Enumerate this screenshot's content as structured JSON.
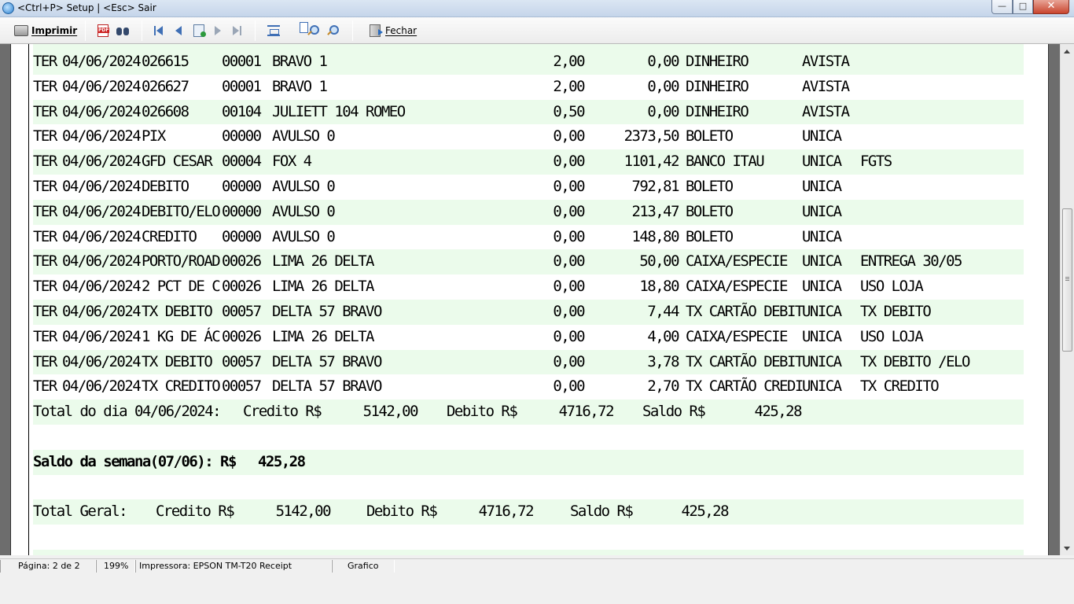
{
  "window": {
    "title": "<Ctrl+P> Setup | <Esc> Sair",
    "controls": {
      "minimize": "—",
      "maximize": "□",
      "close": "✕"
    }
  },
  "toolbar": {
    "print_label": "Imprimir",
    "close_label": "Fechar",
    "icons": [
      "printer-icon",
      "pdf-icon",
      "binoculars-icon",
      "first-page-icon",
      "prev-page-icon",
      "goto-page-icon",
      "next-page-icon",
      "last-page-icon",
      "fit-width-icon",
      "whole-page-icon",
      "zoom-in-icon",
      "zoom-out-icon",
      "exit-icon"
    ]
  },
  "report": {
    "rows": [
      {
        "day": "TER",
        "date": "04/06/2024",
        "doc": "026615",
        "code": "00001",
        "name": "BRAVO 1",
        "debit": "2,00",
        "credit": "0,00",
        "account": "DINHEIRO",
        "cond": "AVISTA",
        "obs": "",
        "green": true
      },
      {
        "day": "TER",
        "date": "04/06/2024",
        "doc": "026627",
        "code": "00001",
        "name": "BRAVO 1",
        "debit": "2,00",
        "credit": "0,00",
        "account": "DINHEIRO",
        "cond": "AVISTA",
        "obs": "",
        "green": false
      },
      {
        "day": "TER",
        "date": "04/06/2024",
        "doc": "026608",
        "code": "00104",
        "name": "JULIETT 104 ROMEO",
        "debit": "0,50",
        "credit": "0,00",
        "account": "DINHEIRO",
        "cond": "AVISTA",
        "obs": "",
        "green": true
      },
      {
        "day": "TER",
        "date": "04/06/2024",
        "doc": "PIX",
        "code": "00000",
        "name": "AVULSO 0",
        "debit": "0,00",
        "credit": "2373,50",
        "account": "BOLETO",
        "cond": "UNICA",
        "obs": "",
        "green": false
      },
      {
        "day": "TER",
        "date": "04/06/2024",
        "doc": "GFD CESAR",
        "code": "00004",
        "name": "FOX 4",
        "debit": "0,00",
        "credit": "1101,42",
        "account": "BANCO ITAU",
        "cond": "UNICA",
        "obs": "FGTS",
        "green": true
      },
      {
        "day": "TER",
        "date": "04/06/2024",
        "doc": "DEBITO",
        "code": "00000",
        "name": "AVULSO 0",
        "debit": "0,00",
        "credit": "792,81",
        "account": "BOLETO",
        "cond": "UNICA",
        "obs": "",
        "green": false
      },
      {
        "day": "TER",
        "date": "04/06/2024",
        "doc": "DEBITO/ELO",
        "code": "00000",
        "name": "AVULSO 0",
        "debit": "0,00",
        "credit": "213,47",
        "account": "BOLETO",
        "cond": "UNICA",
        "obs": "",
        "green": true
      },
      {
        "day": "TER",
        "date": "04/06/2024",
        "doc": "CREDITO",
        "code": "00000",
        "name": "AVULSO 0",
        "debit": "0,00",
        "credit": "148,80",
        "account": "BOLETO",
        "cond": "UNICA",
        "obs": "",
        "green": false
      },
      {
        "day": "TER",
        "date": "04/06/2024",
        "doc": "PORTO/ROAD",
        "code": "00026",
        "name": "LIMA 26 DELTA",
        "debit": "0,00",
        "credit": "50,00",
        "account": "CAIXA/ESPECIE",
        "cond": "UNICA",
        "obs": "ENTREGA 30/05",
        "green": true
      },
      {
        "day": "TER",
        "date": "04/06/2024",
        "doc": "2 PCT DE C",
        "code": "00026",
        "name": "LIMA 26 DELTA",
        "debit": "0,00",
        "credit": "18,80",
        "account": "CAIXA/ESPECIE",
        "cond": "UNICA",
        "obs": "USO LOJA",
        "green": false
      },
      {
        "day": "TER",
        "date": "04/06/2024",
        "doc": "TX DEBITO",
        "code": "00057",
        "name": "DELTA 57 BRAVO",
        "debit": "0,00",
        "credit": "7,44",
        "account": "TX CARTÃO DEBIT",
        "cond": "UNICA",
        "obs": "TX DEBITO",
        "green": true
      },
      {
        "day": "TER",
        "date": "04/06/2024",
        "doc": "1 KG DE ÁC",
        "code": "00026",
        "name": "LIMA 26 DELTA",
        "debit": "0,00",
        "credit": "4,00",
        "account": "CAIXA/ESPECIE",
        "cond": "UNICA",
        "obs": "USO LOJA",
        "green": false
      },
      {
        "day": "TER",
        "date": "04/06/2024",
        "doc": "TX DEBITO",
        "code": "00057",
        "name": "DELTA 57 BRAVO",
        "debit": "0,00",
        "credit": "3,78",
        "account": "TX CARTÃO DEBIT",
        "cond": "UNICA",
        "obs": "TX DEBITO /ELO",
        "green": true
      },
      {
        "day": "TER",
        "date": "04/06/2024",
        "doc": "TX CREDITO",
        "code": "00057",
        "name": "DELTA 57 BRAVO",
        "debit": "0,00",
        "credit": "2,70",
        "account": "TX CARTÃO CREDI",
        "cond": "UNICA",
        "obs": "TX CREDITO",
        "green": false
      }
    ],
    "day_total": {
      "label": "Total do dia 04/06/2024:",
      "credit_label": "Credito R$",
      "credit": "5142,00",
      "debit_label": "Debito R$",
      "debit": "4716,72",
      "balance_label": "Saldo R$",
      "balance": "425,28"
    },
    "week_balance": {
      "label": "Saldo da semana(07/06): R$",
      "value": "425,28"
    },
    "grand_total": {
      "label": "Total Geral:",
      "credit_label": "Credito R$",
      "credit": "5142,00",
      "debit_label": "Debito R$",
      "debit": "4716,72",
      "balance_label": "Saldo R$",
      "balance": "425,28"
    }
  },
  "statusbar": {
    "page": "Página: 2 de 2",
    "zoom": "199%",
    "printer": "Impressora: EPSON TM-T20 Receipt",
    "mode": "Grafico"
  },
  "colors": {
    "row_highlight": "#ebfbeb",
    "viewport_bg": "#6d6d6d"
  }
}
